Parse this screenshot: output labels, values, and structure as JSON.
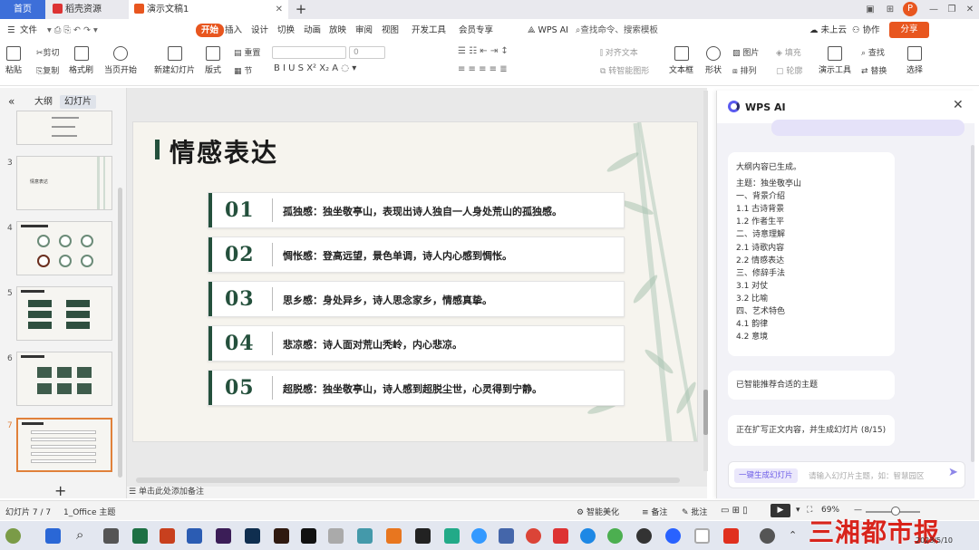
{
  "tabs": {
    "home": "首页",
    "docer": "稻壳资源",
    "doc": "演示文稿1",
    "new": "+"
  },
  "window_controls": {
    "layout": "▣",
    "grid": "⊞",
    "min": "—",
    "restore": "❐",
    "close": "✕"
  },
  "menu": {
    "file": "文件",
    "items": [
      "开始",
      "插入",
      "设计",
      "切换",
      "动画",
      "放映",
      "审阅",
      "视图",
      "开发工具",
      "会员专享"
    ],
    "wps_ai": "WPS AI",
    "search": "查找命令、搜索模板",
    "cloud": "未上云",
    "collab": "协作",
    "share": "分享"
  },
  "ribbon": {
    "paste": "粘贴",
    "cut": "剪切",
    "copy": "复制",
    "format_painter": "格式刷",
    "start_show": "当页开始",
    "new_slide": "新建幻灯片",
    "layout": "版式",
    "section": "节",
    "reset": "重置",
    "font_size": "0",
    "align_text": "对齐文本",
    "smart_shape": "转智能图形",
    "textbox": "文本框",
    "shape": "形状",
    "arrange": "排列",
    "picture": "图片",
    "fill": "填充",
    "outline": "轮廓",
    "present_tools": "演示工具",
    "find": "查找",
    "replace": "替换",
    "select": "选择"
  },
  "panel": {
    "tab_outline": "大纲",
    "tab_slides": "幻灯片",
    "add": "+",
    "slide_numbers": [
      "3",
      "4",
      "5",
      "6",
      "7"
    ],
    "thumb3_title": "情意表达"
  },
  "slide": {
    "title": "情感表达",
    "rows": [
      {
        "num": "01",
        "text": "孤独感：独坐敬亭山，表现出诗人独自一人身处荒山的孤独感。"
      },
      {
        "num": "02",
        "text": "惆怅感：登高远望，景色单调，诗人内心感到惆怅。"
      },
      {
        "num": "03",
        "text": "思乡感：身处异乡，诗人思念家乡，情感真挚。"
      },
      {
        "num": "04",
        "text": "悲凉感：诗人面对荒山秃岭，内心悲凉。"
      },
      {
        "num": "05",
        "text": "超脱感：独坐敬亭山，诗人感到超脱尘世，心灵得到宁静。"
      }
    ]
  },
  "notes": "单击此处添加备注",
  "ai": {
    "title": "WPS AI",
    "outline_lines": [
      "大纲内容已生成。",
      "主题：独坐敬亭山",
      "一、背景介绍",
      "1.1 古诗背景",
      "1.2 作者生平",
      "二、诗意理解",
      "2.1 诗歌内容",
      "2.2 情感表达",
      "三、修辞手法",
      "3.1 对仗",
      "3.2 比喻",
      "四、艺术特色",
      "4.1 韵律",
      "4.2 意境"
    ],
    "msg_theme": "已智能推荐合适的主题",
    "msg_progress": "正在扩写正文内容，并生成幻灯片 (8/15)",
    "gen_button": "一键生成幻灯片",
    "input_placeholder": "请输入幻灯片主题，如：智慧园区",
    "send": "➤"
  },
  "status": {
    "slide_count": "幻灯片 7 / 7",
    "theme": "1_Office 主题",
    "beautify": "智能美化",
    "notes": "备注",
    "comment": "批注",
    "zoom": "69%"
  },
  "watermark": {
    "text": "三湘都市报",
    "date": "2023/5/10"
  }
}
